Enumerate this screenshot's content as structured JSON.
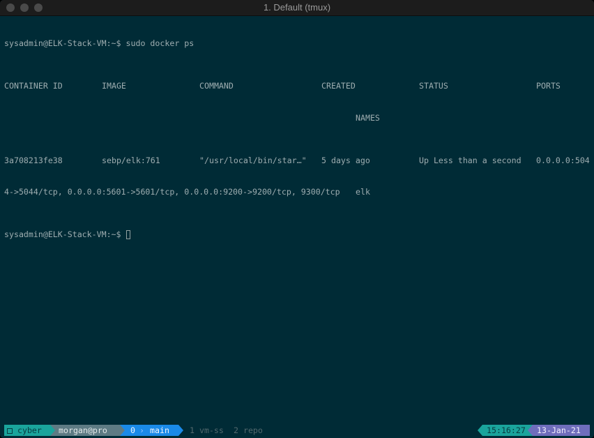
{
  "window": {
    "title": "1. Default (tmux)"
  },
  "terminal": {
    "prompt": "sysadmin@ELK-Stack-VM:~$ ",
    "command": "sudo docker ps",
    "headers": {
      "container_id": "CONTAINER ID",
      "image": "IMAGE",
      "command": "COMMAND",
      "created": "CREATED",
      "status": "STATUS",
      "ports": "PORTS",
      "names": "NAMES"
    },
    "rows": [
      {
        "container_id": "3a708213fe38",
        "image": "sebp/elk:761",
        "command": "\"/usr/local/bin/star…\"",
        "created": "5 days ago",
        "status": "Up Less than a second",
        "ports_line1": "0.0.0.0:504",
        "ports_line2": "4->5044/tcp, 0.0.0.0:5601->5601/tcp, 0.0.0.0:9200->9200/tcp, 9300/tcp",
        "names": "elk"
      }
    ],
    "final_prompt": "sysadmin@ELK-Stack-VM:~$ "
  },
  "statusbar": {
    "session": "cyber",
    "user_host": "morgan@pro",
    "active_window_index": "0",
    "active_window_name": "main",
    "other_windows": [
      {
        "index": "1",
        "name": "vm-ss"
      },
      {
        "index": "2",
        "name": "repo"
      }
    ],
    "time": "15:16:27",
    "date": "13-Jan-21",
    "colors": {
      "session_bg": "#1aa49c",
      "user_bg": "#5e7b84",
      "window_bg": "#1a8ae8",
      "time_bg": "#1aa49c",
      "date_bg": "#6f6dbc"
    }
  }
}
